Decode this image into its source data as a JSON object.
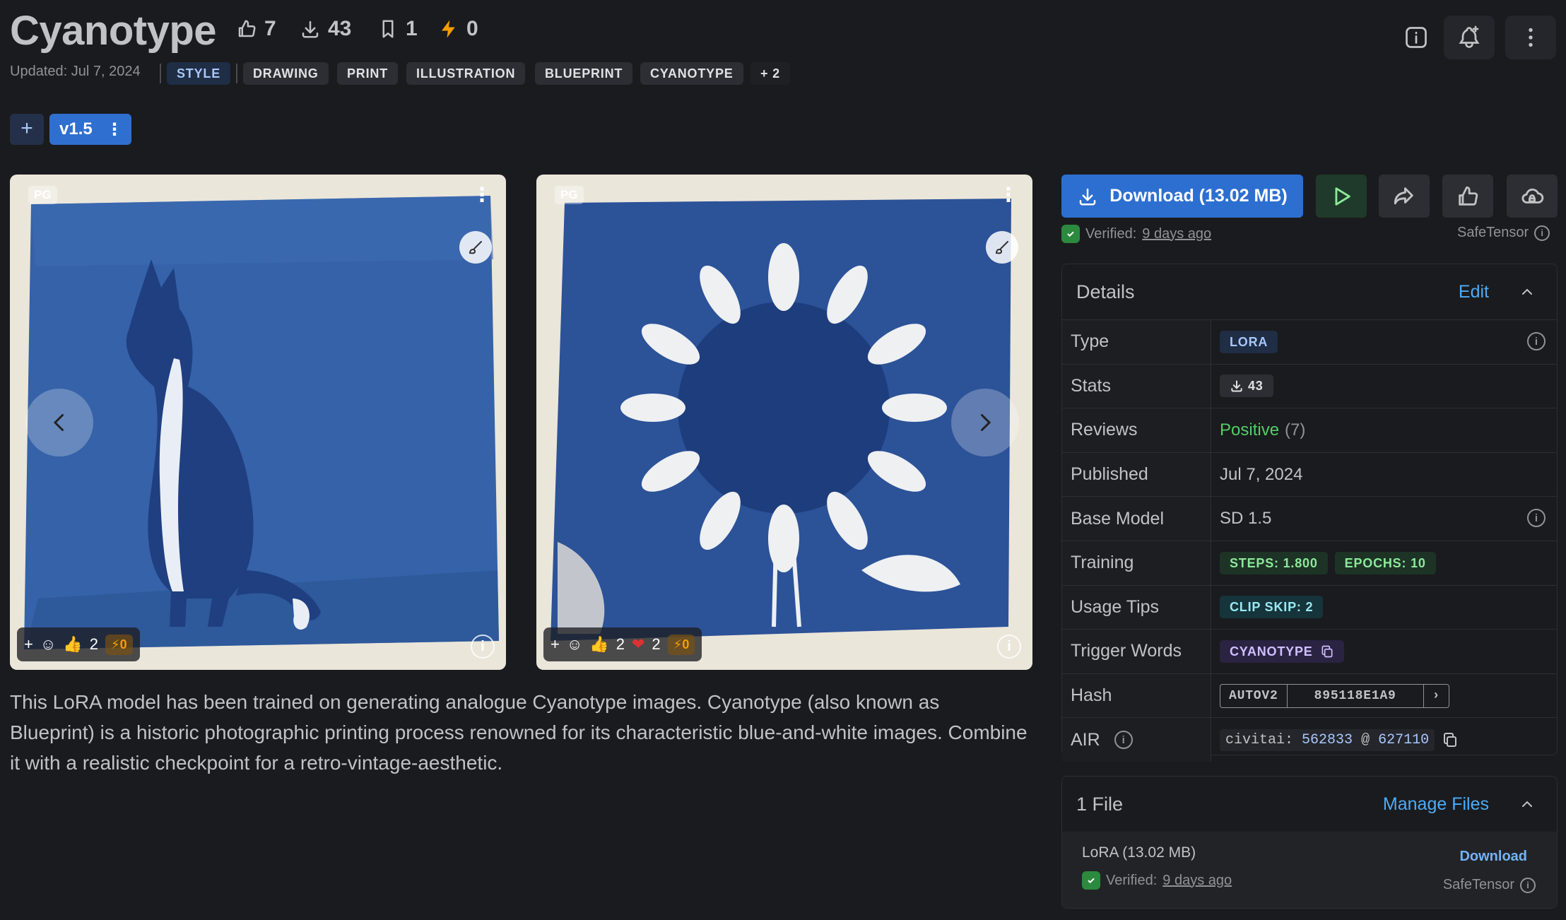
{
  "header": {
    "title": "Cyanotype",
    "likes": "7",
    "downloads": "43",
    "bookmarks": "1",
    "buzz": "0",
    "updated": "Updated: Jul 7, 2024",
    "tags": [
      "STYLE",
      "DRAWING",
      "PRINT",
      "ILLUSTRATION",
      "BLUEPRINT",
      "CYANOTYPE",
      "+ 2"
    ]
  },
  "versions": {
    "add": "+",
    "current": "v1.5",
    "menu": "⋮"
  },
  "gallery": {
    "images": [
      {
        "rating": "PG",
        "thumbs": "2",
        "buzz": "0"
      },
      {
        "rating": "PG",
        "thumbs": "2",
        "hearts": "2",
        "buzz": "0"
      }
    ]
  },
  "description": "This LoRA model has been trained on generating analogue Cyanotype images. Cyanotype (also known as Blueprint) is a historic photographic printing process renowned for its characteristic blue-and-white images. Combine it with a realistic checkpoint for a retro-vintage-aesthetic.",
  "download": {
    "label": "Download (13.02 MB)",
    "verified_prefix": "Verified:",
    "verified_when": "9 days ago",
    "format": "SafeTensor"
  },
  "details": {
    "title": "Details",
    "edit": "Edit",
    "rows": {
      "type_k": "Type",
      "type_v": "LORA",
      "stats_k": "Stats",
      "stats_v": "43",
      "reviews_k": "Reviews",
      "reviews_pos": "Positive",
      "reviews_count": "(7)",
      "published_k": "Published",
      "published_v": "Jul 7, 2024",
      "base_k": "Base Model",
      "base_v": "SD 1.5",
      "training_k": "Training",
      "steps": "STEPS: 1.800",
      "epochs": "EPOCHS: 10",
      "usage_k": "Usage Tips",
      "clip": "CLIP SKIP: 2",
      "trigger_k": "Trigger Words",
      "trigger": "CYANOTYPE",
      "hash_k": "Hash",
      "hash_type": "AUTOV2",
      "hash_v": "895118E1A9",
      "air_k": "AIR",
      "air_prefix": "civitai:",
      "air_model": "562833",
      "air_at": "@",
      "air_version": "627110"
    }
  },
  "files": {
    "title": "1 File",
    "manage": "Manage Files",
    "name": "LoRA (13.02 MB)",
    "download": "Download",
    "verified_prefix": "Verified:",
    "verified_when": "9 days ago",
    "format": "SafeTensor"
  },
  "colors": {
    "accent": "#2d6fd0",
    "link": "#4dabf7",
    "positive": "#51cf66",
    "cyan": "#2c5ba3"
  }
}
